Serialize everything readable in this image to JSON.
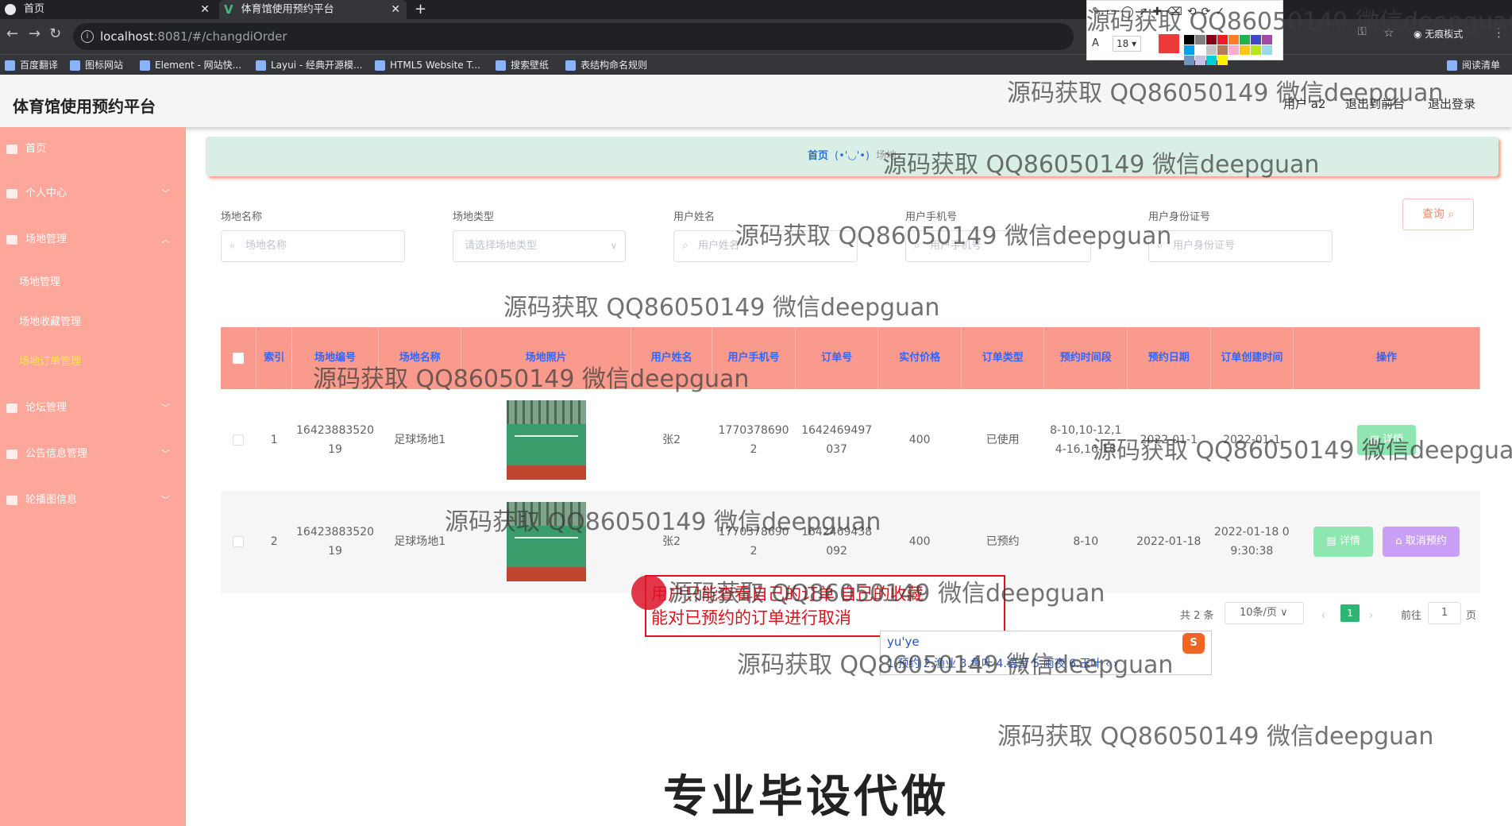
{
  "browser": {
    "tabs": [
      {
        "label": "首页",
        "active": false
      },
      {
        "label": "体育馆使用预约平台",
        "active": true
      }
    ],
    "url_host": "localhost",
    "url_rest": ":8081/#/changdiOrder",
    "bookmarks": [
      "百度翻译",
      "图标网站",
      "Element - 网站快...",
      "Layui - 经典开源模...",
      "HTML5 Website T...",
      "搜索壁纸",
      "表结构命名规则"
    ],
    "incognito_label": "无痕模式",
    "reading_list": "阅读清单"
  },
  "snip_toolbar": {
    "font_size": "18",
    "current_color": "#f03a3a",
    "palette": [
      "#000000",
      "#7f7f7f",
      "#880015",
      "#ed1c24",
      "#ff7f27",
      "#22b14c",
      "#3f48cc",
      "#a349a4",
      "#00a2e8",
      "#ffffff",
      "#c3c3c3",
      "#b97a57",
      "#ffaec9",
      "#ffc90e",
      "#b5e61d",
      "#99d9ea",
      "#7092be",
      "#c8bfe7",
      "#00cfd5",
      "#fff200"
    ]
  },
  "app": {
    "title": "体育馆使用预约平台",
    "header_links": {
      "user": "用户 a2",
      "to_front": "退出到前台",
      "logout": "退出登录"
    },
    "accent_color": "#fca79a"
  },
  "sidebar": {
    "items": [
      {
        "label": "首页",
        "has_chevron": false
      },
      {
        "label": "个人中心",
        "has_chevron": true
      },
      {
        "label": "场地管理",
        "has_chevron": true
      }
    ],
    "subitems": [
      "场地管理",
      "场地收藏管理",
      "场地订单管理"
    ],
    "more_items": [
      {
        "label": "论坛管理",
        "has_chevron": true
      },
      {
        "label": "公告信息管理",
        "has_chevron": true
      },
      {
        "label": "轮播图信息",
        "has_chevron": true
      }
    ]
  },
  "breadcrumb": {
    "home": "首页",
    "face": "(•'◡'•)",
    "current": "场地"
  },
  "filters": {
    "venue_name": {
      "label": "场地名称",
      "placeholder": "场地名称"
    },
    "venue_type": {
      "label": "场地类型",
      "placeholder": "请选择场地类型"
    },
    "user_name": {
      "label": "用户姓名",
      "placeholder": "用户姓名"
    },
    "user_phone": {
      "label": "用户手机号",
      "placeholder": "用户手机号"
    },
    "user_id": {
      "label": "用户身份证号",
      "placeholder": "用户身份证号"
    },
    "search_label": "查询"
  },
  "table": {
    "headers": [
      "索引",
      "场地编号",
      "场地名称",
      "场地照片",
      "用户姓名",
      "用户手机号",
      "订单号",
      "实付价格",
      "订单类型",
      "预约时间段",
      "预约日期",
      "订单创建时间",
      "操作"
    ],
    "rows": [
      {
        "index": "1",
        "venue_no": "1642388352019",
        "venue_name": "足球场地1",
        "user_name": "张2",
        "phone": "17703786902",
        "order_no": "1642469497037",
        "price": "400",
        "order_type": "已使用",
        "time_slots": "8-10,10-12,14-16,16-18",
        "date": "2022-01-1",
        "created": "2022-01-1",
        "actions": [
          "详情"
        ]
      },
      {
        "index": "2",
        "venue_no": "1642388352019",
        "venue_name": "足球场地1",
        "user_name": "张2",
        "phone": "17703786902",
        "order_no": "1642469438092",
        "price": "400",
        "order_type": "已预约",
        "time_slots": "8-10",
        "date": "2022-01-18",
        "created": "2022-01-18 09:30:38",
        "actions": [
          "详情",
          "取消预约"
        ]
      }
    ]
  },
  "pagination": {
    "total": "共 2 条",
    "page_size": "10条/页",
    "current_page": "1",
    "goto_label": "前往",
    "goto_value": "1",
    "page_unit": "页"
  },
  "annotation": {
    "line1": "用户只能查看自己的订单 自己的收藏",
    "line2": "能对已预约的订单进行取消"
  },
  "ime": {
    "composition": "yu'ye",
    "candidates": "1.预约  2.渔业  3.鱼叶  4.语音  5.雨夜  6.玉叶  ‹ ›"
  },
  "watermark": "源码获取 QQ86050149 微信deepguan",
  "caption": "专业毕设代做"
}
